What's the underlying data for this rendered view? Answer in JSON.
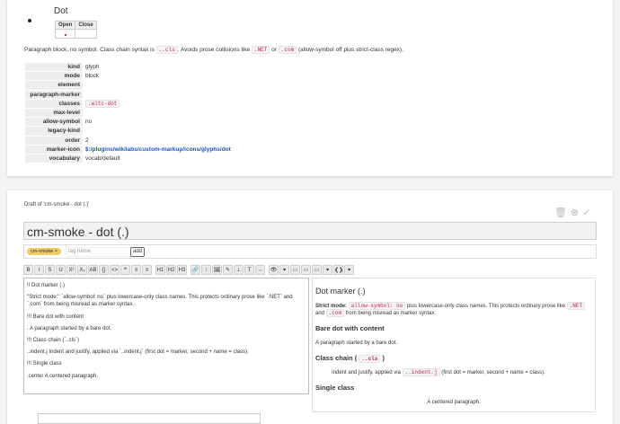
{
  "card1": {
    "title": "Dot",
    "table": {
      "headers": [
        "Open",
        "Close"
      ]
    },
    "paragraph": {
      "pre": "Paragraph block, no symbol. Class chain syntax is ",
      "code1": "..cls",
      "mid": ". Avoids prose collisions like ",
      "code2": ".NET",
      "or": " or ",
      "code3": ".com",
      "post": " (allow-symbol off plus strict-class regex)."
    },
    "fields": [
      {
        "key": "kind",
        "value": "glyph"
      },
      {
        "key": "mode",
        "value": "block"
      },
      {
        "key": "element",
        "value": ""
      },
      {
        "key": "paragraph-marker",
        "value": ""
      },
      {
        "key": "classes",
        "value": ".wltc-dot",
        "code": true
      },
      {
        "key": "max-level",
        "value": ""
      },
      {
        "key": "allow-symbol",
        "value": "no"
      },
      {
        "key": "legacy-kind",
        "value": ""
      },
      {
        "key": "order",
        "value": "2"
      },
      {
        "key": "marker-icon",
        "value": "$:/plugins/wikilabs/custom-markup/icons/glyphs/dot",
        "link": true
      },
      {
        "key": "vocabulary",
        "value": "vocab/default"
      }
    ]
  },
  "card2": {
    "draft_label": "Draft of 'cm-smoke - dot (.)'",
    "title_value": "cm-smoke - dot (.)",
    "tag": "cm-smoke ×",
    "tag_placeholder": "tag name",
    "add_label": "add",
    "toolbar": [
      "B",
      "I",
      "S",
      "U",
      "X²",
      "X₂",
      "AB",
      "{}",
      "<>",
      "❝",
      "≡",
      "≡",
      "H1",
      "H2",
      "H3",
      "🔗",
      "⁝",
      "🖼",
      "✎",
      "⊥",
      "T",
      "⌵",
      "👁",
      "▾",
      "▭",
      "▭",
      "▭",
      "▾",
      "❮❯",
      "▾"
    ],
    "editor_lines": [
      "!! Dot marker (.)",
      "''Strict mode:'' `allow-symbol: no` plus lowercase-only class names. This protects ordinary prose like `.NET` and `.com` from being misread as marker syntax.",
      "!!! Bare dot with content",
      ". A paragraph started by a bare dot.",
      "!!! Class chain (`..cls`)",
      "..indent.j Indent and justify, applied via `..indent.j` (first dot = marker, second + name = class).",
      "!!! Single class",
      ".center A centered paragraph."
    ],
    "preview": {
      "h1": "Dot marker (.)",
      "strict_label": "Strict mode:",
      "strict_code": "allow-symbol: no",
      "strict_text1": " plus lowercase-only class names. This protects ordinary prose like ",
      "strict_code2": ".NET",
      "strict_and": " and ",
      "strict_code3": ".com",
      "strict_text2": " from being misread as marker syntax.",
      "h2a": "Bare dot with content",
      "p1": "A paragraph started by a bare dot.",
      "h2b_pre": "Class chain (",
      "h2b_code": "..cls",
      "h2b_post": ")",
      "indent_pre": "Indent and justify, applied via ",
      "indent_code": "..indent.j",
      "indent_post": " (first dot = marker, second + name = class).",
      "h2c": "Single class",
      "centered": "A centered paragraph."
    }
  }
}
